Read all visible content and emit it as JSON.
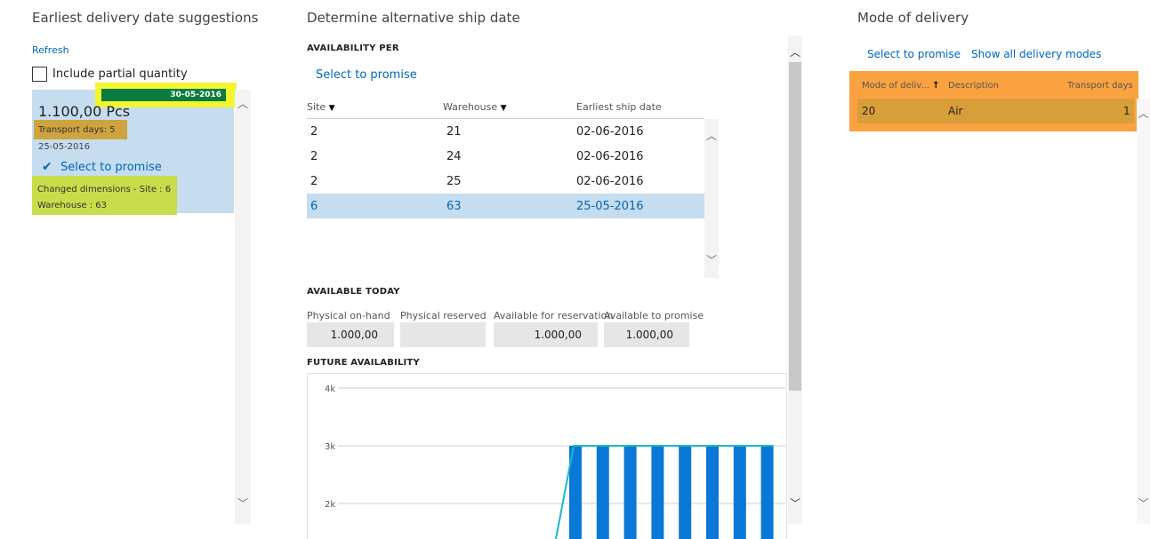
{
  "left": {
    "title": "Earliest delivery date suggestions",
    "refresh": "Refresh",
    "include_partial": "Include partial quantity",
    "card": {
      "date": "30-05-2016",
      "quantity": "1.100,00 Pcs",
      "transport": "Transport days: 5",
      "sub_date": "25-05-2016",
      "select": "Select to promise",
      "changed_1": "Changed dimensions - Site : 6",
      "changed_2": "Warehouse : 63"
    }
  },
  "middle": {
    "title": "Determine alternative ship date",
    "availability_per": "AVAILABILITY PER",
    "select": "Select to promise",
    "columns": [
      "Site",
      "Warehouse",
      "Earliest ship date"
    ],
    "rows": [
      {
        "site": "2",
        "warehouse": "21",
        "date": "02-06-2016"
      },
      {
        "site": "2",
        "warehouse": "24",
        "date": "02-06-2016"
      },
      {
        "site": "2",
        "warehouse": "25",
        "date": "02-06-2016"
      },
      {
        "site": "6",
        "warehouse": "63",
        "date": "25-05-2016"
      }
    ],
    "available_today": "AVAILABLE TODAY",
    "fields": [
      {
        "label": "Physical on-hand",
        "value": "1.000,00"
      },
      {
        "label": "Physical reserved",
        "value": ""
      },
      {
        "label": "Available for reservation",
        "value": "1.000,00"
      },
      {
        "label": "Available to promise",
        "value": "1.000,00"
      }
    ],
    "future": "FUTURE AVAILABILITY"
  },
  "chart_data": {
    "type": "bar",
    "y_ticks": [
      "4k",
      "3k",
      "2k"
    ],
    "ylim": [
      1800,
      4000
    ],
    "bar_values": [
      3000,
      3000,
      3000,
      3000,
      3000,
      3000,
      3000,
      3000
    ],
    "line_value": 3000,
    "bar_color": "#0a78d7",
    "line_color": "#1bb7c6"
  },
  "right": {
    "title": "Mode of delivery",
    "select": "Select to promise",
    "show_all": "Show all delivery modes",
    "columns": [
      "Mode of deliv...",
      "Description",
      "Transport days"
    ],
    "rows": [
      {
        "mode": "20",
        "description": "Air",
        "days": "1"
      }
    ]
  },
  "colors": {
    "accent": "#0067b8",
    "selection": "#c6dcef",
    "orange": "#fba240",
    "yellow_highlight": "#f2f530",
    "green_date": "#0a7c3f"
  }
}
